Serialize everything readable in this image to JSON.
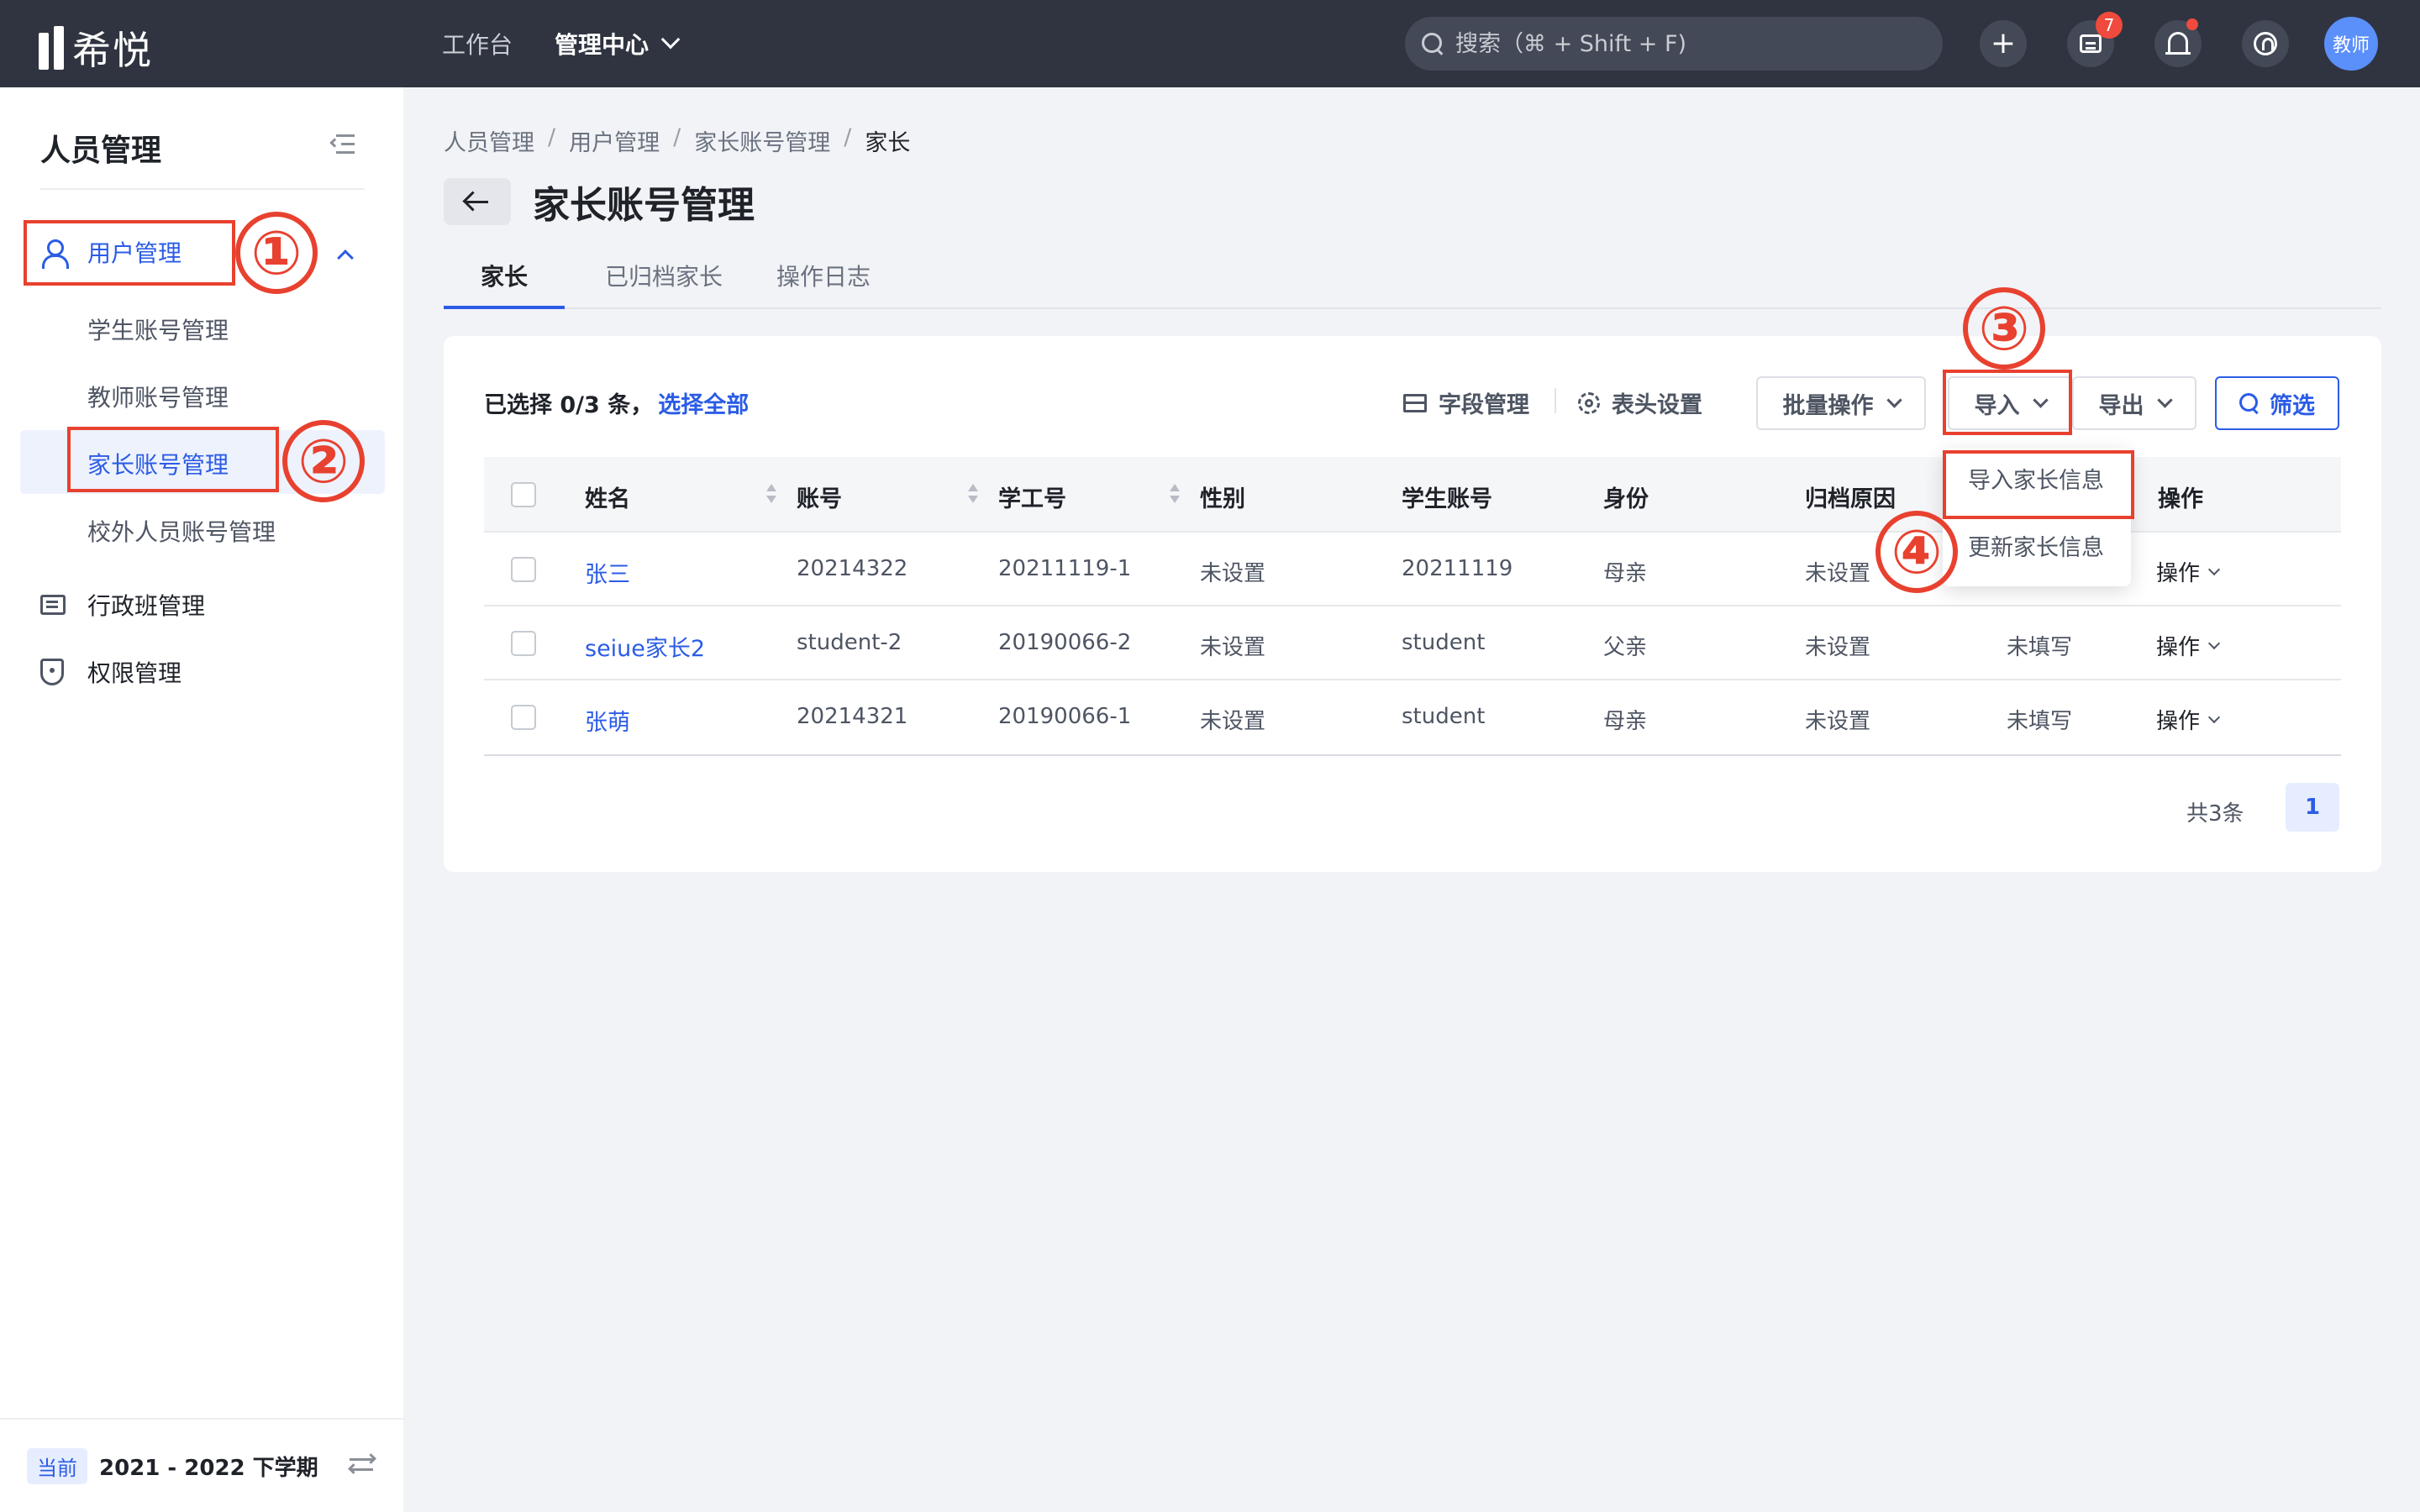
{
  "app": {
    "logo_text": "希悦"
  },
  "topnav": {
    "items": [
      {
        "label": "工作台"
      },
      {
        "label": "管理中心"
      }
    ]
  },
  "search": {
    "placeholder": "搜索（⌘ + Shift + F)"
  },
  "topbar": {
    "plus_glyph": "+",
    "message_badge": "7",
    "avatar_label": "教师"
  },
  "sidebar": {
    "title": "人员管理",
    "group_label": "用户管理",
    "sub_items": [
      {
        "label": "学生账号管理"
      },
      {
        "label": "教师账号管理"
      },
      {
        "label": "家长账号管理"
      },
      {
        "label": "校外人员账号管理"
      }
    ],
    "items": [
      {
        "label": "行政班管理"
      },
      {
        "label": "权限管理"
      }
    ],
    "footer": {
      "badge": "当前",
      "term": "2021 - 2022 下学期"
    }
  },
  "breadcrumb": [
    "人员管理",
    "用户管理",
    "家长账号管理",
    "家长"
  ],
  "breadcrumb_sep": "/",
  "page": {
    "title": "家长账号管理"
  },
  "tabs": [
    {
      "label": "家长"
    },
    {
      "label": "已归档家长"
    },
    {
      "label": "操作日志"
    }
  ],
  "toolbar": {
    "selection_text": "已选择 0/3 条，",
    "select_all": "选择全部",
    "field_manage": "字段管理",
    "header_settings": "表头设置",
    "batch_label": "批量操作",
    "import_label": "导入",
    "export_label": "导出",
    "filter_label": "筛选"
  },
  "table": {
    "headers": [
      "姓名",
      "账号",
      "学工号",
      "性别",
      "学生账号",
      "身份",
      "归档原因",
      "",
      "操作"
    ],
    "rows": [
      {
        "name": "张三",
        "account": "20214322",
        "work_no": "20211119-1",
        "gender": "未设置",
        "student_account": "20211119",
        "identity": "母亲",
        "archive_reason": "未设置",
        "extra": "",
        "action": "操作"
      },
      {
        "name": "seiue家长2",
        "account": "student-2",
        "work_no": "20190066-2",
        "gender": "未设置",
        "student_account": "student",
        "identity": "父亲",
        "archive_reason": "未设置",
        "extra": "未填写",
        "action": "操作"
      },
      {
        "name": "张萌",
        "account": "20214321",
        "work_no": "20190066-1",
        "gender": "未设置",
        "student_account": "student",
        "identity": "母亲",
        "archive_reason": "未设置",
        "extra": "未填写",
        "action": "操作"
      }
    ]
  },
  "pagination": {
    "total": "共3条",
    "current": "1"
  },
  "import_menu": {
    "items": [
      {
        "label": "导入家长信息"
      },
      {
        "label": "更新家长信息"
      }
    ]
  },
  "annotations": {
    "numbers": [
      "①",
      "②",
      "③",
      "④"
    ],
    "color": "#e8412f"
  },
  "colors": {
    "topbar_bg": "#2f3440",
    "accent": "#2b5ce6",
    "page_bg": "#f2f3f6"
  }
}
